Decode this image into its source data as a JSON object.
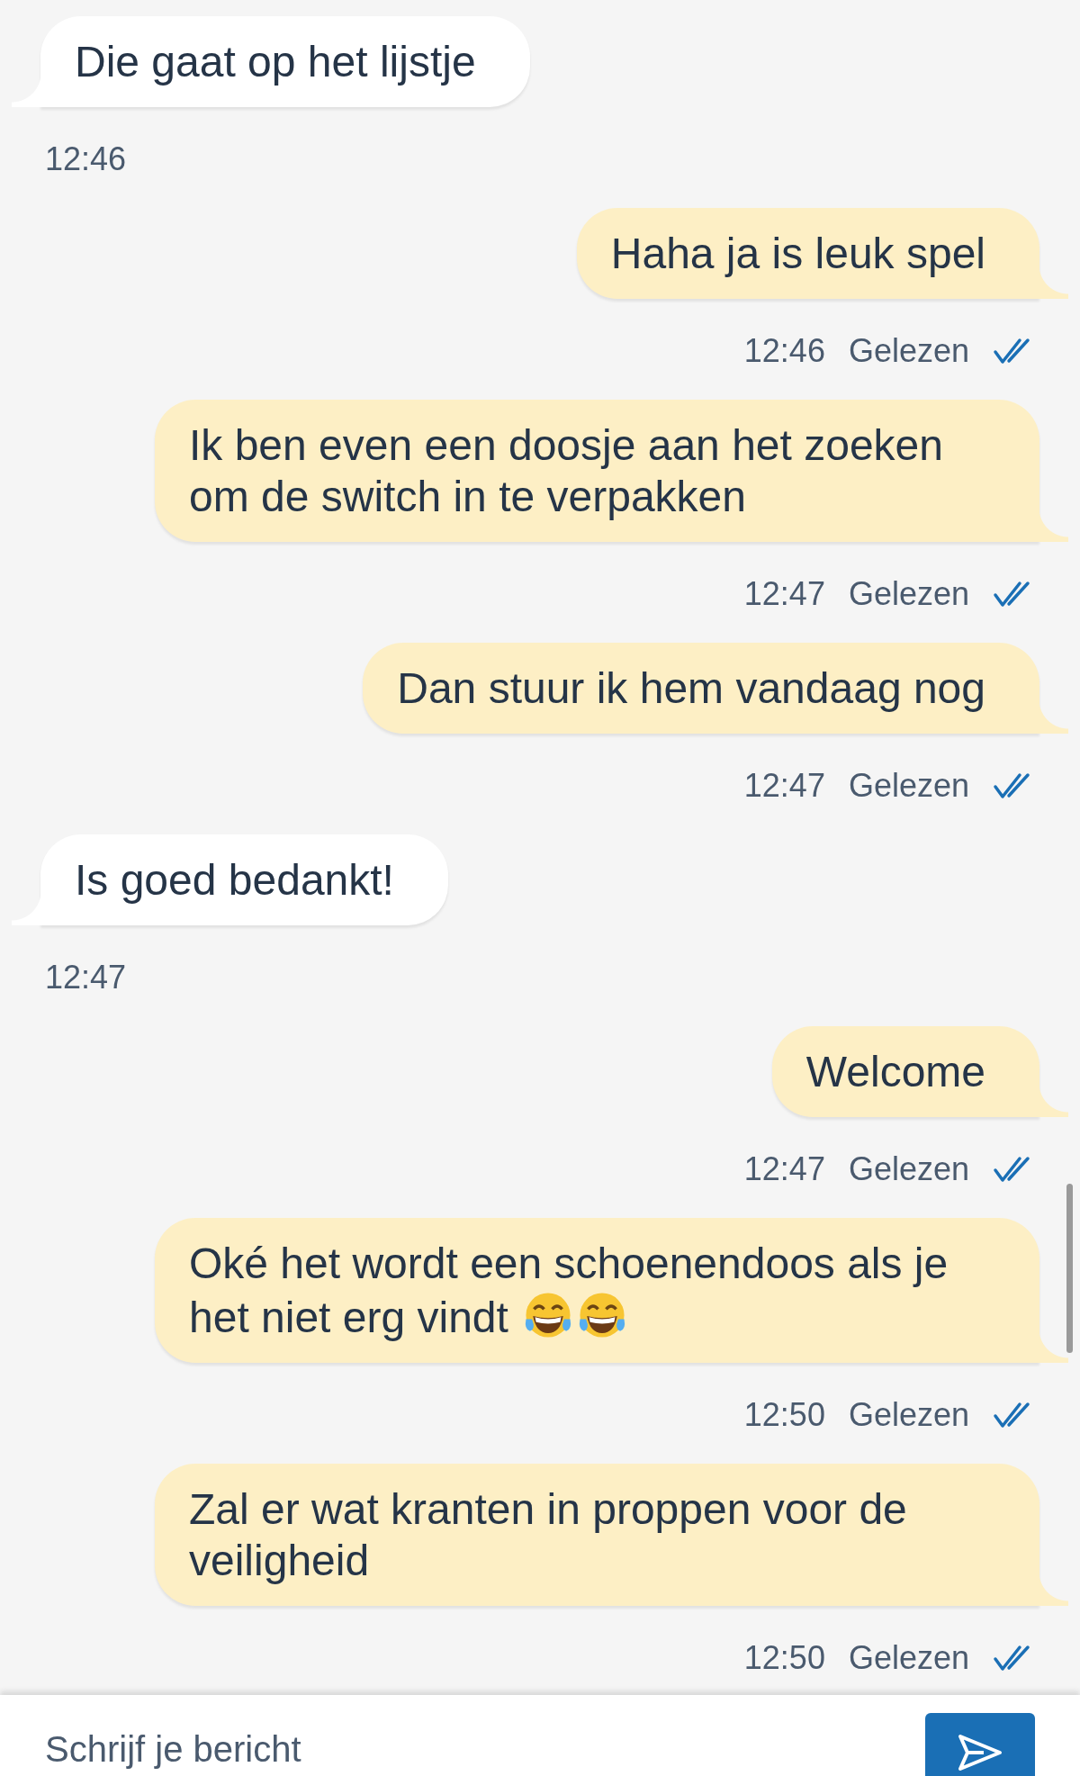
{
  "messages": [
    {
      "kind": "received",
      "text": "Die gaat op het lijstje",
      "time": "12:46"
    },
    {
      "kind": "sent",
      "text": "Haha ja is leuk spel",
      "time": "12:46",
      "status": "Gelezen",
      "read": true
    },
    {
      "kind": "sent",
      "text": "Ik ben even een doosje aan het zoeken om de switch in te verpakken",
      "time": "12:47",
      "status": "Gelezen",
      "read": true
    },
    {
      "kind": "sent",
      "text": "Dan stuur ik hem vandaag nog",
      "time": "12:47",
      "status": "Gelezen",
      "read": true
    },
    {
      "kind": "received",
      "text": "Is goed bedankt!",
      "time": "12:47"
    },
    {
      "kind": "sent",
      "text": "Welcome",
      "time": "12:47",
      "status": "Gelezen",
      "read": true
    },
    {
      "kind": "sent",
      "text": "Oké het wordt een schoenendoos als je het niet erg vindt",
      "emojis": [
        {
          "kind": "tears-of-joy"
        },
        {
          "kind": "tears-of-joy"
        }
      ],
      "time": "12:50",
      "status": "Gelezen",
      "read": true
    },
    {
      "kind": "sent",
      "text": "Zal er wat kranten in proppen voor de veiligheid",
      "time": "12:50",
      "status": "Gelezen",
      "read": true
    }
  ],
  "composer": {
    "placeholder": "Schrijf je bericht"
  }
}
